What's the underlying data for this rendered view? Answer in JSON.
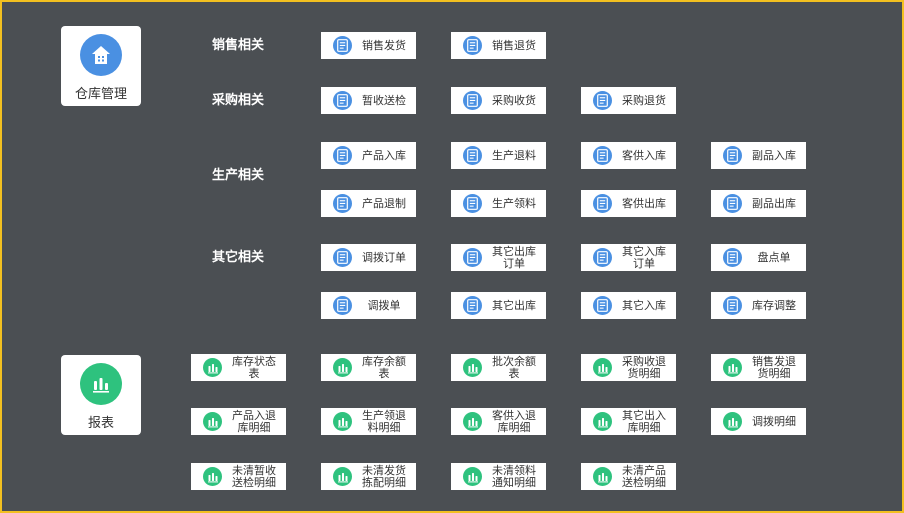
{
  "sidebar": {
    "warehouse": {
      "label": "仓库管理",
      "icon": "warehouse-icon",
      "color": "#4a90e2"
    },
    "reports": {
      "label": "报表",
      "icon": "bar-chart-icon",
      "color": "#2ec27e"
    }
  },
  "categories": {
    "sales": "销售相关",
    "purchase": "采购相关",
    "production": "生产相关",
    "other": "其它相关"
  },
  "buttons": {
    "sales_shipment": "销售发货",
    "sales_return": "销售退货",
    "temp_receive_inspect": "暂收送检",
    "purchase_receive": "采购收货",
    "purchase_return": "采购退货",
    "product_in": "产品入库",
    "production_return_material": "生产退料",
    "customer_supplied_in": "客供入库",
    "byproduct_in": "副品入库",
    "product_return_rework": "产品退制",
    "production_pick": "生产领料",
    "customer_supplied_out": "客供出库",
    "byproduct_out": "副品出库",
    "transfer_order": "调拨订单",
    "other_out_order": "其它出库\n订单",
    "other_in_order": "其它入库\n订单",
    "stocktake_order": "盘点单",
    "transfer_slip": "调拨单",
    "other_out": "其它出库",
    "other_in": "其它入库",
    "inventory_adjust": "库存调整"
  },
  "reports": {
    "stock_status": "库存状态\n表",
    "stock_balance": "库存余额\n表",
    "batch_balance": "批次余额\n表",
    "purchase_receive_return_detail": "采购收退\n货明细",
    "sales_ship_return_detail": "销售发退\n货明细",
    "product_in_return_detail": "产品入退\n库明细",
    "production_pick_return_detail": "生产领退\n料明细",
    "customer_supplied_in_return_detail": "客供入退\n库明细",
    "other_in_out_detail": "其它出入\n库明细",
    "transfer_detail": "调拨明细",
    "uncleared_temp_inspect_detail": "未清暂收\n送检明细",
    "uncleared_shipment_pick_detail": "未清发货\n拣配明细",
    "uncleared_pick_notice_detail": "未清领料\n通知明细",
    "uncleared_product_inspect_detail": "未清产品\n送检明细"
  },
  "colors": {
    "background": "#4b4f53",
    "frame_border": "#f2c020",
    "document_icon": "#4a90e2",
    "report_icon": "#2ec27e"
  }
}
